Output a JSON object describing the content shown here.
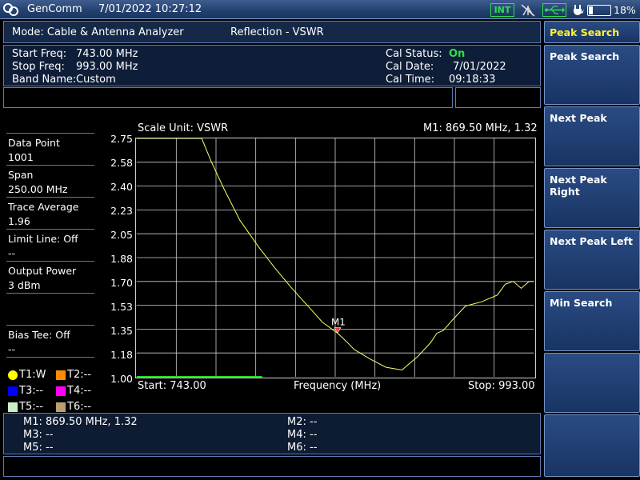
{
  "topbar": {
    "app_name": "GenComm",
    "datetime": "7/01/2022 10:27:12",
    "int_badge": "INT",
    "battery": "18%",
    "icons": [
      "logo-icon",
      "antenna-off-icon",
      "usb-icon",
      "plug-icon",
      "battery-icon"
    ]
  },
  "header": {
    "mode": "Mode: Cable & Antenna Analyzer",
    "measurement": "Reflection - VSWR"
  },
  "settings": {
    "start_label": "Start Freq:",
    "start_value": "743.00 MHz",
    "stop_label": "Stop Freq:",
    "stop_value": "993.00 MHz",
    "band_label": "Band Name:",
    "band_value": "Custom",
    "cal_status_label": "Cal Status:",
    "cal_status_value": "On",
    "cal_date_label": "Cal Date:",
    "cal_date_value": "7/01/2022",
    "cal_time_label": "Cal Time:",
    "cal_time_value": "09:18:33"
  },
  "info_panel": {
    "data_point_label": "Data Point",
    "data_point_value": "1001",
    "span_label": "Span",
    "span_value": "250.00 MHz",
    "trace_avg_label": "Trace Average",
    "trace_avg_value": "1.96",
    "limit_line": "Limit Line: Off",
    "limit_value": "--",
    "output_power_label": "Output Power",
    "output_power_value": "3 dBm",
    "bias_tee": "Bias Tee: Off",
    "bias_value": "--",
    "traces": [
      {
        "label": "T1:W",
        "color": "#ffff00"
      },
      {
        "label": "T2:--",
        "color": "#ff8c00"
      },
      {
        "label": "T3:--",
        "color": "#0000ff"
      },
      {
        "label": "T4:--",
        "color": "#ff00ff"
      },
      {
        "label": "T5:--",
        "color": "#c8f0c8"
      },
      {
        "label": "T6:--",
        "color": "#b8a070"
      }
    ]
  },
  "chart_data": {
    "type": "line",
    "scale_unit": "Scale Unit: VSWR",
    "marker_readout": "M1: 869.50 MHz, 1.32",
    "xlabel": "Frequency (MHz)",
    "start_label": "Start: 743.00",
    "stop_label": "Stop: 993.00",
    "xlim": [
      743,
      993
    ],
    "ylim": [
      1.0,
      2.75
    ],
    "y_ticks": [
      "2.75",
      "2.58",
      "2.40",
      "2.23",
      "2.05",
      "1.88",
      "1.70",
      "1.53",
      "1.35",
      "1.18",
      "1.00"
    ],
    "grid": true,
    "trace_color": "#ffff66",
    "series": [
      {
        "x": [
          743,
          780,
          784,
          790,
          798,
          808,
          820,
          830,
          840,
          850,
          860,
          869.5,
          875,
          880,
          890,
          900,
          910,
          920,
          928,
          932,
          936,
          942,
          950,
          960,
          970,
          975,
          980,
          985,
          990,
          993
        ],
        "y": [
          2.85,
          2.85,
          2.75,
          2.58,
          2.38,
          2.15,
          1.95,
          1.8,
          1.66,
          1.53,
          1.4,
          1.32,
          1.26,
          1.2,
          1.13,
          1.07,
          1.05,
          1.15,
          1.25,
          1.32,
          1.34,
          1.42,
          1.52,
          1.55,
          1.6,
          1.68,
          1.7,
          1.65,
          1.7,
          1.7
        ]
      }
    ],
    "markers": [
      {
        "name": "M1",
        "x": 869.5,
        "y": 1.32
      }
    ]
  },
  "marker_table": {
    "m1": "M1: 869.50 MHz, 1.32",
    "m2": "M2: --",
    "m3": "M3: --",
    "m4": "M4: --",
    "m5": "M5: --",
    "m6": "M6: --"
  },
  "softkeys": {
    "title": "Peak Search",
    "items": [
      "Peak Search",
      "Next Peak",
      "Next Peak Right",
      "Next Peak Left",
      "Min Search",
      "",
      ""
    ]
  }
}
